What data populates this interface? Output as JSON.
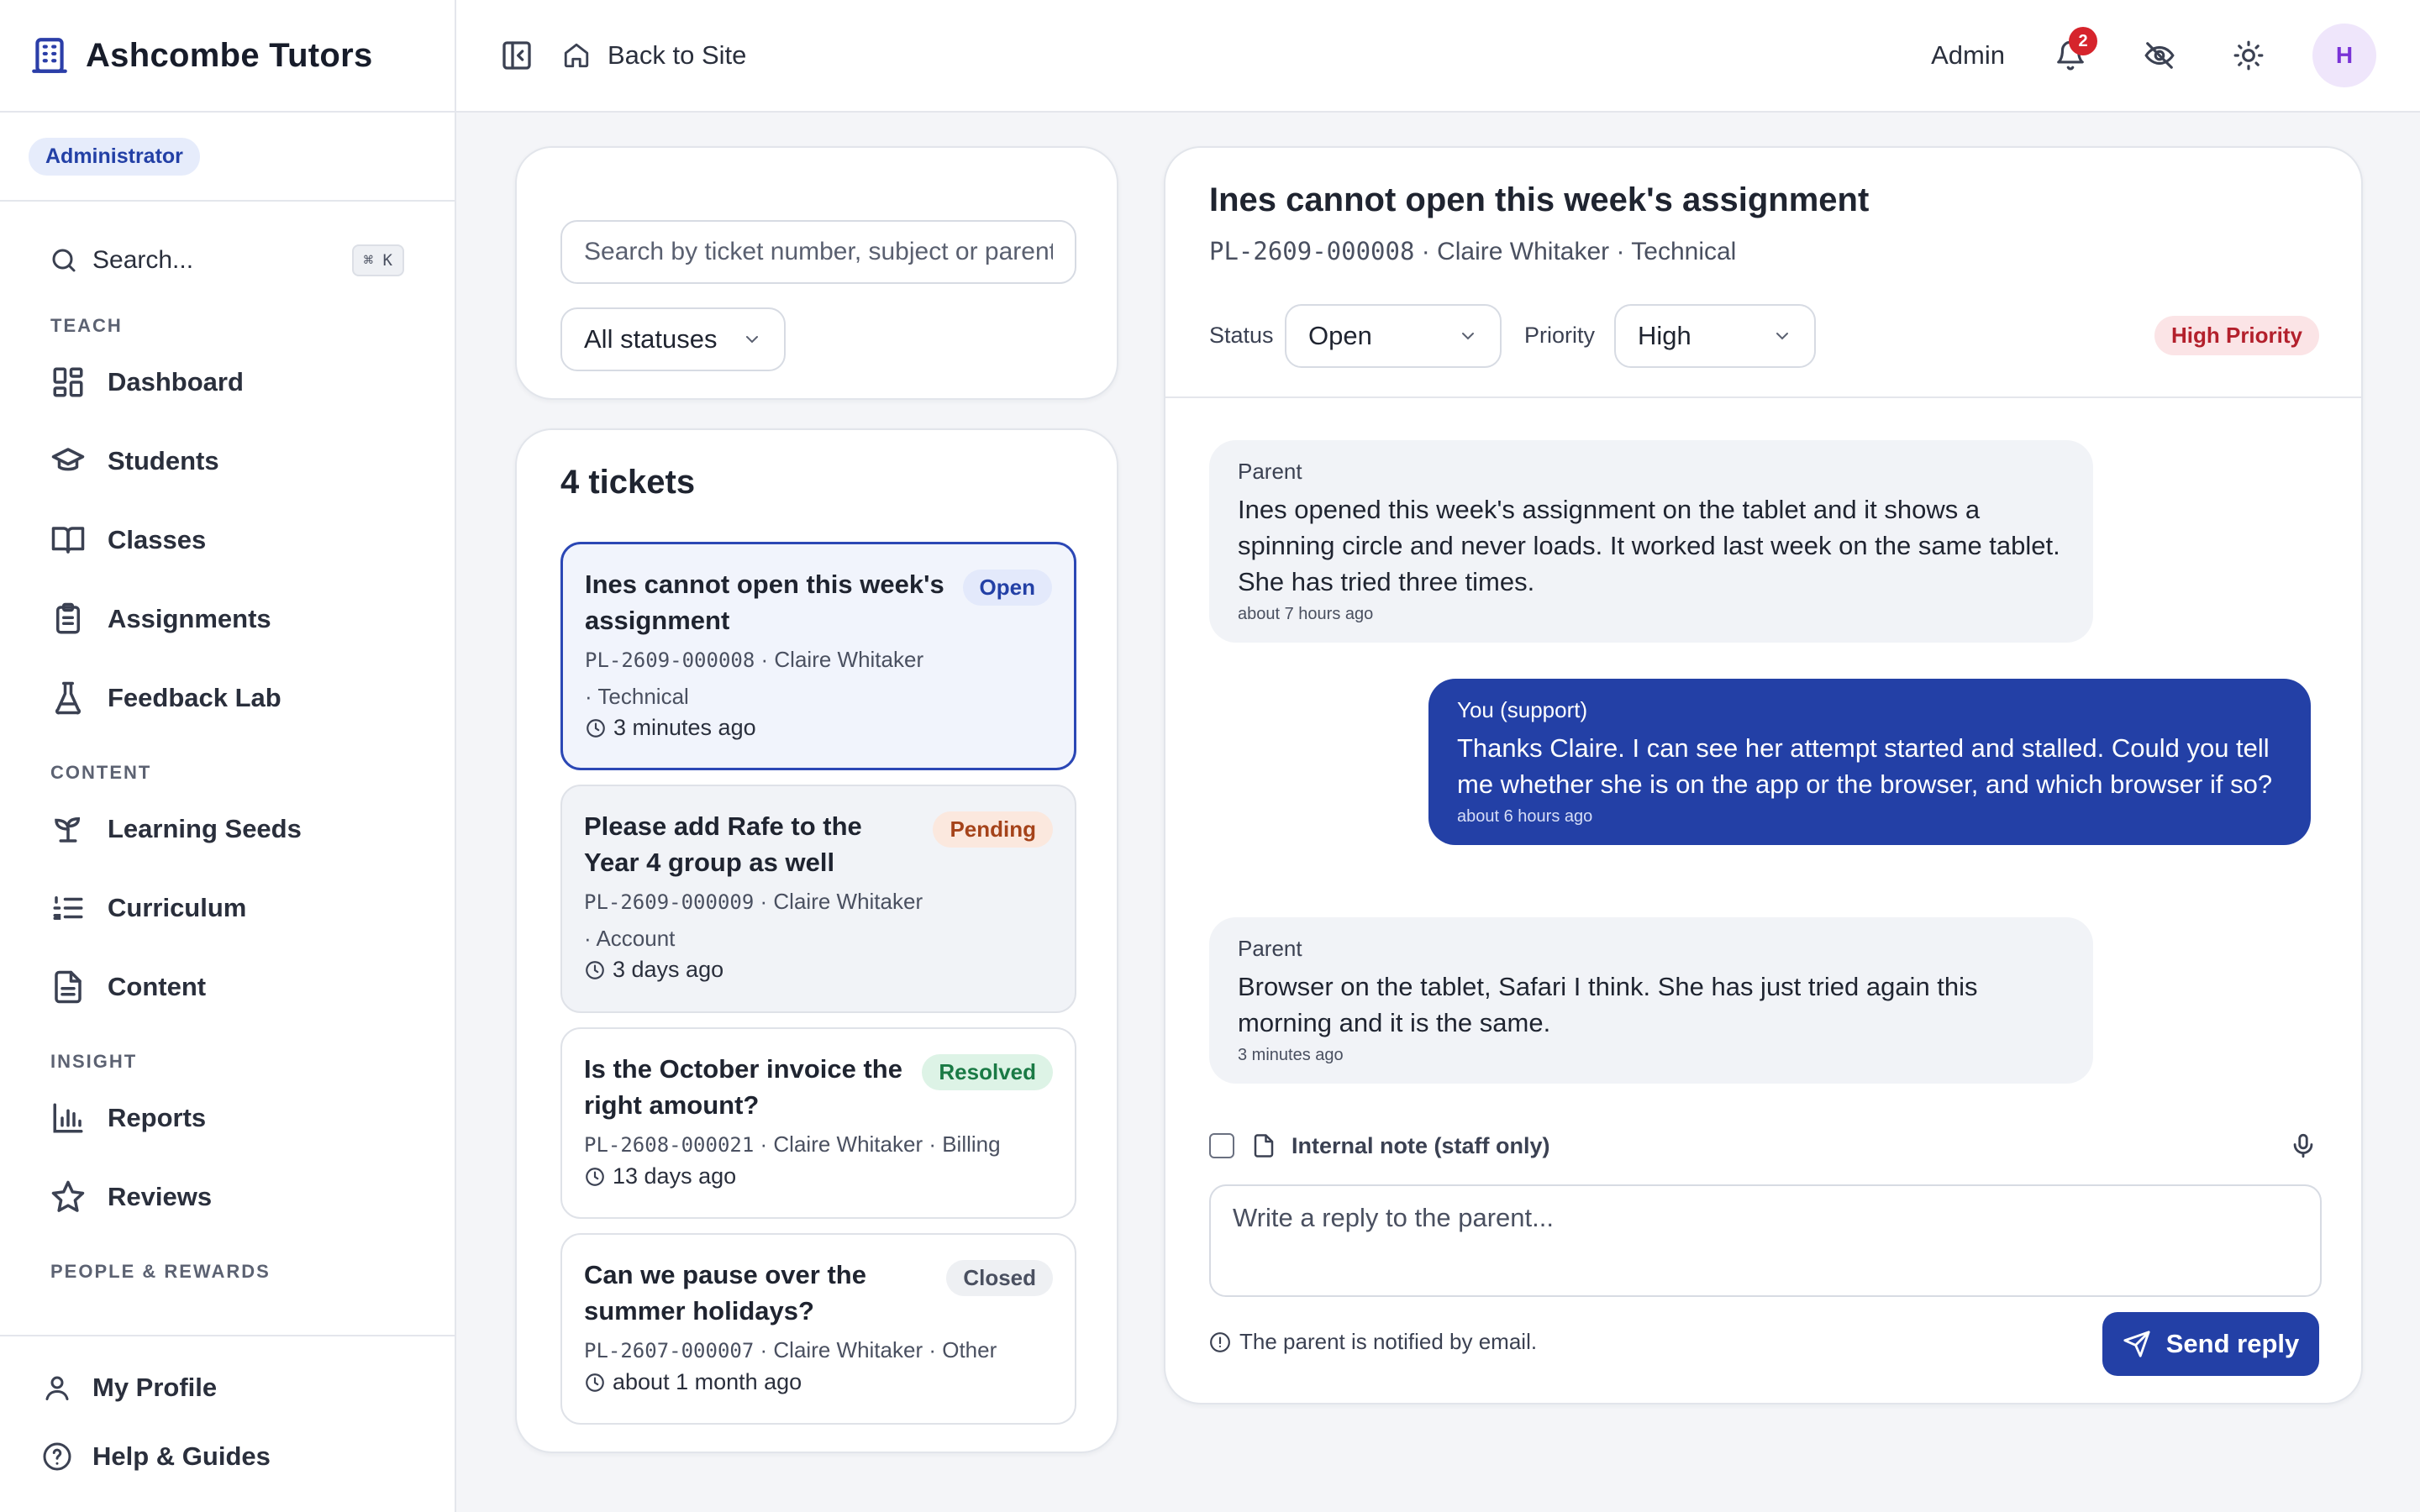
{
  "app": {
    "name": "Ashcombe Tutors",
    "role": "Administrator"
  },
  "sidebar": {
    "search_label": "Search...",
    "search_shortcut": "⌘ K",
    "sections": [
      {
        "title": "TEACH",
        "items": [
          {
            "label": "Dashboard",
            "icon": "dashboard-icon"
          },
          {
            "label": "Students",
            "icon": "graduation-cap-icon"
          },
          {
            "label": "Classes",
            "icon": "book-icon"
          },
          {
            "label": "Assignments",
            "icon": "clipboard-icon"
          },
          {
            "label": "Feedback Lab",
            "icon": "flask-icon"
          }
        ]
      },
      {
        "title": "CONTENT",
        "items": [
          {
            "label": "Learning Seeds",
            "icon": "sprout-icon"
          },
          {
            "label": "Curriculum",
            "icon": "list-ordered-icon"
          },
          {
            "label": "Content",
            "icon": "file-text-icon"
          }
        ]
      },
      {
        "title": "INSIGHT",
        "items": [
          {
            "label": "Reports",
            "icon": "bar-chart-icon"
          },
          {
            "label": "Reviews",
            "icon": "star-icon"
          }
        ]
      },
      {
        "title": "PEOPLE & REWARDS",
        "items": []
      }
    ],
    "bottom": [
      {
        "label": "My Profile",
        "icon": "user-icon"
      },
      {
        "label": "Help & Guides",
        "icon": "help-circle-icon"
      }
    ]
  },
  "header": {
    "back_label": "Back to Site",
    "admin_label": "Admin",
    "notification_count": "2",
    "avatar_initial": "H"
  },
  "filters": {
    "search_placeholder": "Search by ticket number, subject or parent",
    "status_value": "All statuses"
  },
  "ticket_list": {
    "count_label": "4 tickets",
    "tickets": [
      {
        "title": "Ines cannot open this week's assignment",
        "status": "Open",
        "code": "PL-2609-000008",
        "meta_rest": " · Claire Whitaker",
        "meta_line2": "· Technical",
        "time": "3 minutes ago"
      },
      {
        "title": "Please add Rafe to the Year 4 group as well",
        "status": "Pending",
        "code": "PL-2609-000009",
        "meta_rest": " · Claire Whitaker",
        "meta_line2": "· Account",
        "time": "3 days ago"
      },
      {
        "title": "Is the October invoice the right amount?",
        "status": "Resolved",
        "code": "PL-2608-000021",
        "meta_rest": " · Claire Whitaker  · Billing",
        "time": "13 days ago"
      },
      {
        "title": "Can we pause over the summer holidays?",
        "status": "Closed",
        "code": "PL-2607-000007",
        "meta_rest": " · Claire Whitaker  · Other",
        "time": "about 1 month ago"
      }
    ]
  },
  "detail": {
    "title": "Ines cannot open this week's assignment",
    "code": "PL-2609-000008",
    "sub_rest": " · Claire Whitaker · Technical",
    "status_label": "Status",
    "status_value": "Open",
    "priority_label": "Priority",
    "priority_value": "High",
    "priority_badge": "High Priority",
    "messages": [
      {
        "author": "Parent",
        "body": "Ines opened this week's assignment on the tablet and it shows a spinning circle and never loads. It worked last week on the same tablet. She has tried three times.",
        "time": "about 7 hours ago"
      },
      {
        "author": "You (support)",
        "body": "Thanks Claire. I can see her attempt started and stalled. Could you tell me whether she is on the app or the browser, and which browser if so?",
        "time": "about 6 hours ago"
      },
      {
        "author": "Parent",
        "body": "Browser on the tablet, Safari I think. She has just tried again this morning and it is the same.",
        "time": "3 minutes ago"
      }
    ],
    "internal_note_label": "Internal note (staff only)",
    "reply_placeholder": "Write a reply to the parent...",
    "notify_text": "The parent is notified by email.",
    "send_label": "Send reply"
  },
  "colors": {
    "accent": "#2340a6",
    "danger": "#d6242c"
  }
}
